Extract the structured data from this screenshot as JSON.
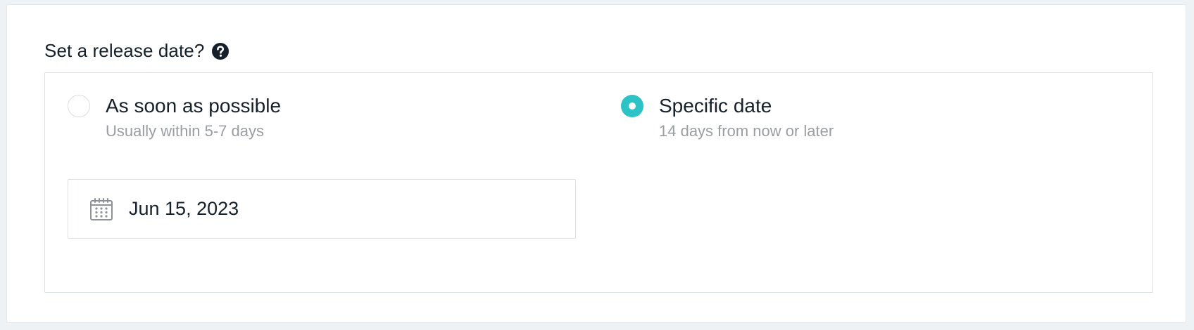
{
  "release": {
    "title": "Set a release date?",
    "help_icon": "question-circle-icon",
    "options": [
      {
        "label": "As soon as possible",
        "subtitle": "Usually within 5-7 days",
        "selected": false
      },
      {
        "label": "Specific date",
        "subtitle": "14 days from now or later",
        "selected": true
      }
    ],
    "date_input": {
      "icon": "calendar-icon",
      "value": "Jun 15, 2023"
    }
  },
  "colors": {
    "accent": "#2dc3c6",
    "text": "#16202b",
    "muted": "#9a9da2",
    "border": "#dcdfe3",
    "page_bg": "#eef2f5"
  }
}
